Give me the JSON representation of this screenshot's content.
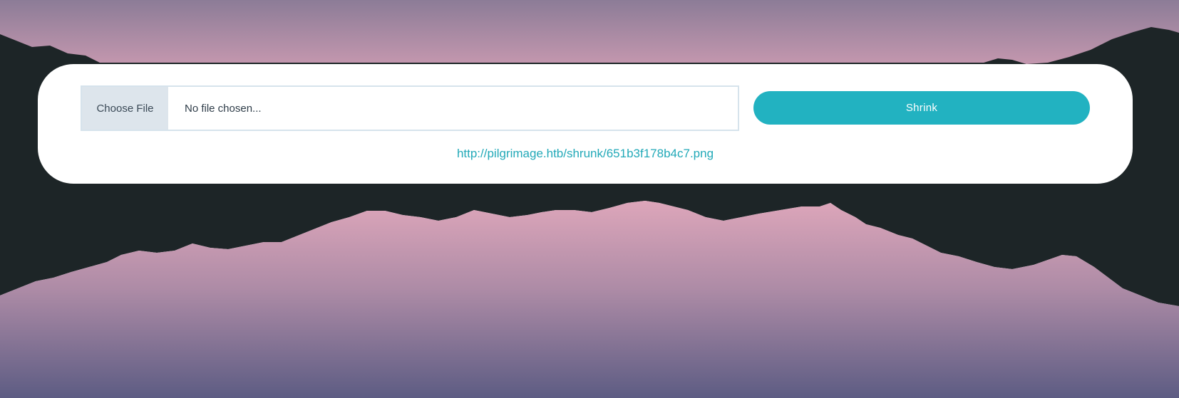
{
  "form": {
    "choose_file_label": "Choose File",
    "file_name_placeholder": "No file chosen...",
    "shrink_label": "Shrink"
  },
  "result": {
    "link_text": "http://pilgrimage.htb/shrunk/651b3f178b4c7.png"
  },
  "colors": {
    "accent": "#22b2c1",
    "mountain": "#1d2527",
    "sky_top": "#8e7c96",
    "sky_pink": "#d4a1b6"
  }
}
